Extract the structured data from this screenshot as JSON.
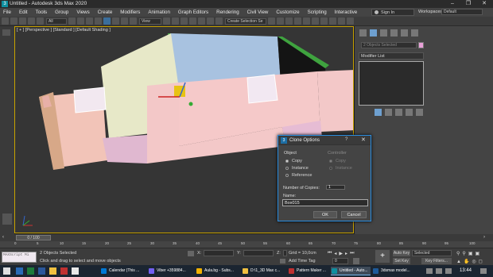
{
  "window": {
    "title": "Untitled - Autodesk 3ds Max 2020",
    "app_icon": "3"
  },
  "menu": [
    "File",
    "Edit",
    "Tools",
    "Group",
    "Views",
    "Create",
    "Modifiers",
    "Animation",
    "Graph Editors",
    "Rendering",
    "Civil View",
    "Customize",
    "Scripting",
    "Interactive"
  ],
  "header_right": {
    "sign_in": "Sign In",
    "workspaces_label": "Workspaces:",
    "workspaces_value": "Default"
  },
  "toolbar": {
    "filter": "All",
    "view": "View",
    "selection_set": "Create Selection Se"
  },
  "viewport": {
    "label": "[ + ] [Perspective ] [Standard ] [Default Shading ]"
  },
  "command_panel": {
    "name_placeholder": "2 Objects Selected",
    "modifier_list": "Modifier List",
    "color": "#e8a0d8"
  },
  "dialog": {
    "title": "Clone Options",
    "help": "?",
    "close": "✕",
    "object_group": "Object",
    "controller_group": "Controller",
    "object_options": [
      "Copy",
      "Instance",
      "Reference"
    ],
    "selected_option": "Copy",
    "controller_options": [
      "Copy",
      "Instance"
    ],
    "copies_label": "Number of Copies:",
    "copies_value": "1",
    "name_label": "Name:",
    "name_value": "Box015",
    "ok": "OK",
    "cancel": "Cancel"
  },
  "timeline": {
    "frame": "0 / 100",
    "ticks": [
      "0",
      "5",
      "10",
      "15",
      "20",
      "25",
      "30",
      "35",
      "40",
      "45",
      "50",
      "55",
      "60",
      "65",
      "70",
      "75",
      "80",
      "85",
      "90",
      "95",
      "100"
    ]
  },
  "status": {
    "maxscript": "MAXScript Mi",
    "selected": "2 Objects Selected",
    "hint": "Click and drag to select and move objects",
    "x_label": "X:",
    "y_label": "Y:",
    "z_label": "Z:",
    "grid": "Grid = 10,0cm",
    "add_time_tag": "Add Time Tag",
    "auto_key": "Auto Key",
    "set_key": "Set Key",
    "selected_dd": "Selected",
    "key_filters": "Key Filters...",
    "frame_field": "0"
  },
  "taskbar": {
    "items": [
      {
        "label": "Calendar (This ...",
        "color": "#0078d4"
      },
      {
        "label": "Viber +359884...",
        "color": "#7360f2"
      },
      {
        "label": "Aula.bg - Subs...",
        "color": "#f2b100"
      },
      {
        "label": "D:\\1_3D Max c...",
        "color": "#f0c040"
      },
      {
        "label": "Pattern Maker ...",
        "color": "#c03030"
      },
      {
        "label": "Untitled - Auto...",
        "color": "#0f8fa0"
      },
      {
        "label": "3dsmax model...",
        "color": "#1e5a99"
      }
    ],
    "time": "13:44"
  }
}
